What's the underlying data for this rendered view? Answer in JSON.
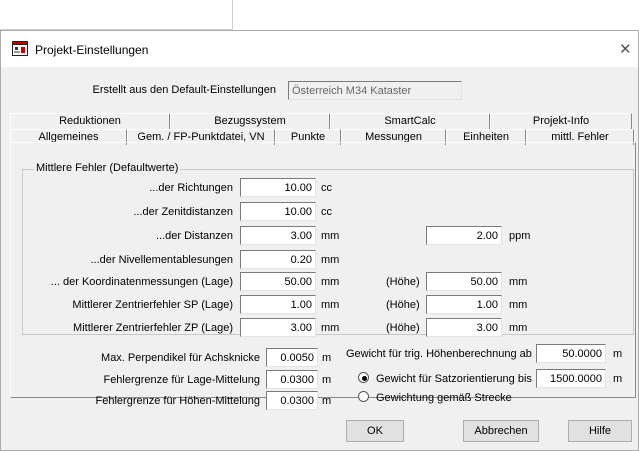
{
  "window": {
    "title": "Projekt-Einstellungen",
    "close_glyph": "✕"
  },
  "header": {
    "created_from_label": "Erstellt aus den Default-Einstellungen",
    "created_from_value": "Österreich M34 Kataster"
  },
  "tabs_back": [
    "Reduktionen",
    "Bezugssystem",
    "SmartCalc",
    "Projekt-Info"
  ],
  "tabs_front": [
    "Allgemeines",
    "Gem. / FP-Punktdatei, VN",
    "Punkte",
    "Messungen",
    "Einheiten",
    "mittl. Fehler"
  ],
  "group": {
    "title": "Mittlere Fehler (Defaultwerte)",
    "rows": [
      {
        "label": "...der Richtungen",
        "value": "10.00",
        "unit": "cc"
      },
      {
        "label": "...der Zenitdistanzen",
        "value": "10.00",
        "unit": "cc"
      },
      {
        "label": "...der Distanzen",
        "value": "3.00",
        "unit": "mm",
        "extra_value": "2.00",
        "extra_unit": "ppm"
      },
      {
        "label": "...der Nivellementablesungen",
        "value": "0.20",
        "unit": "mm"
      },
      {
        "label": "... der Koordinatenmessungen (Lage)",
        "value": "50.00",
        "unit": "mm",
        "extra_label": "(Höhe)",
        "extra_value": "50.00",
        "extra_unit": "mm"
      },
      {
        "label": "Mittlerer Zentrierfehler SP (Lage)",
        "value": "1.00",
        "unit": "mm",
        "extra_label": "(Höhe)",
        "extra_value": "1.00",
        "extra_unit": "mm"
      },
      {
        "label": "Mittlerer Zentrierfehler ZP (Lage)",
        "value": "3.00",
        "unit": "mm",
        "extra_label": "(Höhe)",
        "extra_value": "3.00",
        "extra_unit": "mm"
      }
    ]
  },
  "lower": {
    "perp_label": "Max. Perpendikel für Achsknicke",
    "perp_value": "0.0050",
    "perp_unit": "m",
    "lage_label": "Fehlergrenze für Lage-Mittelung",
    "lage_value": "0.0300",
    "lage_unit": "m",
    "hoehe_label": "Fehlergrenze für Höhen-Mittelung",
    "hoehe_value": "0.0300",
    "hoehe_unit": "m",
    "trig_label": "Gewicht für trig. Höhenberechnung ab",
    "trig_value": "50.0000",
    "trig_unit": "m",
    "radio1_label": "Gewicht für Satzorientierung bis",
    "radio1_value": "1500.0000",
    "radio1_unit": "m",
    "radio2_label": "Gewichtung gemäß Strecke"
  },
  "buttons": {
    "ok": "OK",
    "cancel": "Abbrechen",
    "help": "Hilfe"
  }
}
